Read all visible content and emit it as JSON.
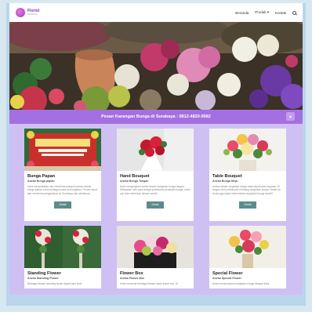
{
  "brand": {
    "name": "Florist",
    "tagline": "Surabaya"
  },
  "nav": {
    "items": [
      "Beranda",
      "Produk ▾",
      "Kontak"
    ]
  },
  "banner": {
    "text": "Pesan Karangan Bunga di Surabaya : 0812-4820-9582"
  },
  "products": [
    {
      "title": "Bunga Papan",
      "subtitle": "Aneka Bunga papan",
      "description": "Kami menyediakan dan menerima pesanan aneka desain bunga papan untuk berbagai acara and kegiatan. Proses cepat dan menerima pengantaran ke Surabaya dan sekitarnya.",
      "button": "Detail"
    },
    {
      "title": "Hand Bouquet",
      "subtitle": "Aneka Bunga Tangan",
      "description": "Kami mengerjakan aneka desain rangkaian bunga tangan. Dikerjakan oleh para tenaga profesional penataan bunga, anda pun bisa memesan desain sendiri.",
      "button": "Detail"
    },
    {
      "title": "Table Bouquet",
      "subtitle": "Aneka Bunga Meja",
      "description": "Aneka desain rangkaian bunga meja dapat kami kerjakan. Di tangan oleh profesional di bidang rangkaian bunga. Selain itu Anda juga dapat menentukan rangkaian bunga sendiri.",
      "button": "Detail"
    },
    {
      "title": "Standing Flower",
      "subtitle": "Aneka Standing Flower",
      "description": "Berbagai desain standing flower dapat kami buat"
    },
    {
      "title": "Flower Box",
      "subtitle": "Aneka Flower Box",
      "description": "Kami membuat berbagai desain rakuk flower box. Di"
    },
    {
      "title": "Special Flower",
      "subtitle": "Aneka Special Flower",
      "description": "Anda membutuhkan rangkaian bunga dengan tidak"
    }
  ],
  "colors": {
    "banner": "#a46fe0",
    "content_bg": "#cfc0f4",
    "button": "#5b8b8a",
    "frame": "#bad6ec"
  }
}
